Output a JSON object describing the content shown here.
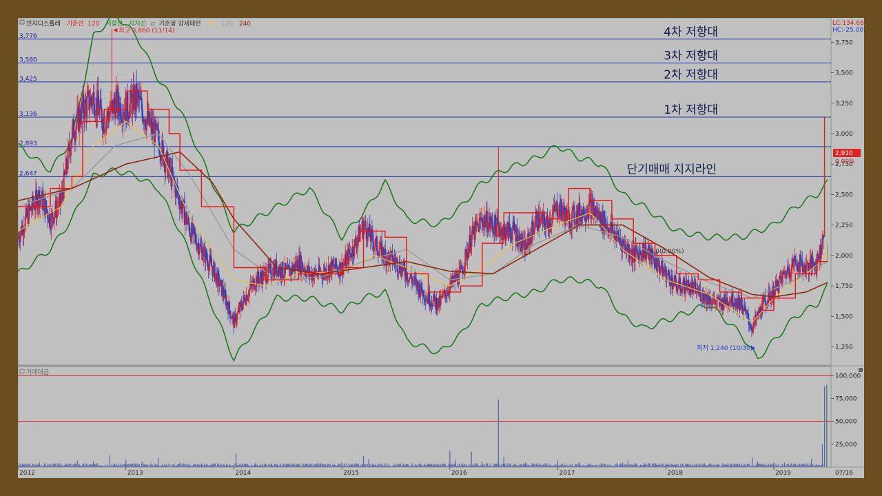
{
  "legend": {
    "title": "인지디스플레",
    "items": [
      {
        "text": "기준선",
        "color": "#dd2222"
      },
      {
        "text": "120",
        "color": "#dd2222"
      },
      {
        "text": "저항선",
        "color": "#228822"
      },
      {
        "text": "지지선",
        "color": "#228822"
      },
      {
        "text": "기준봉 강세패턴",
        "color": "#333333"
      },
      {
        "text": "60",
        "color": "#e6c24a"
      },
      {
        "text": "120",
        "color": "#999999"
      },
      {
        "text": "240",
        "color": "#8b2a10"
      }
    ]
  },
  "top_right": {
    "lc": "LC:134.68",
    "hc": "HC:-25.00"
  },
  "price_box": {
    "value": "2,910",
    "pct": "0.00%"
  },
  "volume_label": "거래대금",
  "right_marker": "07/16",
  "colors": {
    "level_line": "#2233aa",
    "price_up": "#dd2222",
    "price_down": "#2244cc",
    "ma60": "#e6c24a",
    "ma120": "#999999",
    "ma240": "#8b2a10",
    "baseline": "#ee1111",
    "band": "#1e7a1e",
    "volume": "#5566aa"
  },
  "chart_data": [
    {
      "type": "line",
      "ylim": [
        1100,
        3950
      ],
      "x_tick_labels": [
        "2012",
        "2013",
        "2014",
        "2015",
        "2016",
        "2017",
        "2018",
        "2019"
      ],
      "y_ticks": [
        1250,
        1500,
        1750,
        2000,
        2250,
        2500,
        2750,
        3000,
        3250,
        3500,
        3750
      ],
      "y_tick_labels": [
        "1,250",
        "1,500",
        "1,750",
        "2,000",
        "2,250",
        "2,500",
        "2,750",
        "3,000",
        "3,250",
        "3,500",
        "3,750"
      ],
      "levels": [
        {
          "value": 3776,
          "label": "3,776",
          "zone": "4차 저항대"
        },
        {
          "value": 3580,
          "label": "3,580",
          "zone": "3차 저항대"
        },
        {
          "value": 3425,
          "label": "3,425",
          "zone": "2차 저항대"
        },
        {
          "value": 3136,
          "label": "3,136",
          "zone": "1차 저항대"
        },
        {
          "value": 2893,
          "label": "2,893",
          "zone": ""
        },
        {
          "value": 2647,
          "label": "2,647",
          "zone": "단기매매 지지라인"
        }
      ],
      "annotations": [
        {
          "text": "최고 3,860 (11/14)",
          "x": 2012.87,
          "y": 3860
        },
        {
          "text": "최저 1,240 (10/30)",
          "x": 2018.83,
          "y": 1240
        },
        {
          "text": "2,0(0.00%)",
          "x": 2017.85,
          "y": 2020
        }
      ],
      "series": [
        {
          "role": "close",
          "x": [
            2012.0,
            2012.1,
            2012.2,
            2012.3,
            2012.4,
            2012.5,
            2012.6,
            2012.7,
            2012.8,
            2012.9,
            2013.0,
            2013.1,
            2013.2,
            2013.3,
            2013.4,
            2013.5,
            2013.6,
            2013.7,
            2013.8,
            2013.9,
            2014.0,
            2014.1,
            2014.2,
            2014.3,
            2014.4,
            2014.5,
            2014.6,
            2014.7,
            2014.8,
            2014.9,
            2015.0,
            2015.1,
            2015.2,
            2015.3,
            2015.4,
            2015.5,
            2015.6,
            2015.7,
            2015.8,
            2015.9,
            2016.0,
            2016.1,
            2016.2,
            2016.3,
            2016.4,
            2016.5,
            2016.6,
            2016.7,
            2016.8,
            2016.9,
            2017.0,
            2017.1,
            2017.2,
            2017.3,
            2017.4,
            2017.5,
            2017.6,
            2017.7,
            2017.8,
            2017.9,
            2018.0,
            2018.1,
            2018.2,
            2018.3,
            2018.4,
            2018.5,
            2018.6,
            2018.7,
            2018.8,
            2018.9,
            2019.0,
            2019.1,
            2019.2,
            2019.3,
            2019.4,
            2019.45,
            2019.5
          ],
          "values": [
            2150,
            2350,
            2500,
            2300,
            2450,
            3000,
            3200,
            3300,
            3100,
            3250,
            3200,
            3300,
            3100,
            2950,
            2700,
            2450,
            2200,
            2050,
            1900,
            1700,
            1450,
            1650,
            1800,
            1850,
            1900,
            1850,
            1950,
            1850,
            1850,
            1900,
            1900,
            2050,
            2250,
            2100,
            2000,
            1950,
            1850,
            1750,
            1650,
            1600,
            1750,
            1850,
            2150,
            2300,
            2250,
            2200,
            2200,
            2050,
            2300,
            2250,
            2400,
            2300,
            2350,
            2400,
            2300,
            2200,
            2100,
            2000,
            2050,
            1950,
            1850,
            1750,
            1750,
            1700,
            1650,
            1600,
            1650,
            1600,
            1400,
            1600,
            1700,
            1850,
            1950,
            1900,
            1950,
            2100,
            2700
          ]
        },
        {
          "name": "60",
          "x": [
            2012.0,
            2012.4,
            2012.7,
            2013.0,
            2013.3,
            2013.6,
            2014.0,
            2014.3,
            2014.6,
            2015.0,
            2015.3,
            2015.6,
            2016.0,
            2016.3,
            2016.6,
            2017.0,
            2017.3,
            2017.6,
            2018.0,
            2018.4,
            2018.8,
            2019.0,
            2019.3,
            2019.5
          ],
          "values": [
            2200,
            2400,
            2900,
            3100,
            2900,
            2300,
            1800,
            1750,
            1850,
            1870,
            2000,
            1900,
            1750,
            1900,
            2100,
            2250,
            2350,
            2050,
            1800,
            1680,
            1450,
            1650,
            1850,
            2000
          ]
        },
        {
          "name": "120",
          "x": [
            2012.0,
            2012.5,
            2012.9,
            2013.3,
            2013.6,
            2014.0,
            2014.4,
            2014.8,
            2015.2,
            2015.6,
            2016.0,
            2016.4,
            2016.8,
            2017.2,
            2017.6,
            2018.0,
            2018.4,
            2018.8,
            2019.2,
            2019.5
          ],
          "values": [
            2400,
            2550,
            2900,
            3000,
            2650,
            2050,
            1800,
            1820,
            1950,
            2050,
            1800,
            1850,
            2100,
            2250,
            2150,
            1950,
            1780,
            1650,
            1800,
            1950
          ]
        },
        {
          "name": "240",
          "x": [
            2012.0,
            2012.5,
            2013.0,
            2013.5,
            2013.8,
            2014.0,
            2014.4,
            2014.8,
            2015.2,
            2015.6,
            2016.0,
            2016.4,
            2016.8,
            2017.2,
            2017.6,
            2018.0,
            2018.4,
            2018.8,
            2019.0,
            2019.3,
            2019.5
          ],
          "values": [
            2450,
            2550,
            2750,
            2850,
            2600,
            2300,
            1900,
            1850,
            1900,
            1950,
            1870,
            1850,
            2050,
            2250,
            2250,
            2050,
            1820,
            1680,
            1660,
            1700,
            1780
          ]
        },
        {
          "name": "기준선",
          "x": [
            2012.0,
            2012.3,
            2012.5,
            2012.6,
            2012.8,
            2013.0,
            2013.2,
            2013.4,
            2013.5,
            2013.7,
            2014.0,
            2014.3,
            2014.6,
            2015.0,
            2015.2,
            2015.4,
            2015.6,
            2015.8,
            2016.1,
            2016.3,
            2016.5,
            2016.7,
            2016.9,
            2017.1,
            2017.3,
            2017.5,
            2017.7,
            2017.9,
            2018.1,
            2018.3,
            2018.5,
            2018.7,
            2018.9,
            2019.0,
            2019.2,
            2019.4,
            2019.5
          ],
          "values": [
            2400,
            2550,
            2650,
            3100,
            3200,
            3350,
            3200,
            3000,
            2700,
            2400,
            1900,
            1800,
            1850,
            1900,
            2200,
            2150,
            1850,
            1700,
            1750,
            2100,
            2350,
            2350,
            2300,
            2550,
            2450,
            2300,
            2100,
            2000,
            1850,
            1800,
            1700,
            1650,
            1550,
            1650,
            1850,
            1950,
            2100
          ]
        },
        {
          "name": "저항선",
          "x": [
            2012.0,
            2012.3,
            2012.5,
            2012.7,
            2012.9,
            2013.1,
            2013.3,
            2013.5,
            2013.7,
            2014.0,
            2014.4,
            2014.7,
            2015.0,
            2015.2,
            2015.4,
            2015.6,
            2015.9,
            2016.1,
            2016.3,
            2016.5,
            2016.8,
            2017.0,
            2017.2,
            2017.4,
            2017.6,
            2017.8,
            2018.1,
            2018.4,
            2018.7,
            2019.0,
            2019.2,
            2019.4,
            2019.5
          ],
          "values": [
            2900,
            2700,
            2950,
            3800,
            3980,
            3800,
            3450,
            3200,
            2800,
            2200,
            2400,
            2550,
            2150,
            2350,
            2600,
            2300,
            2250,
            2400,
            2600,
            2700,
            2800,
            2900,
            2800,
            2750,
            2500,
            2400,
            2200,
            2150,
            2150,
            2250,
            2400,
            2500,
            2600
          ]
        },
        {
          "name": "지지선",
          "x": [
            2012.0,
            2012.3,
            2012.5,
            2012.7,
            2012.9,
            2013.1,
            2013.3,
            2013.5,
            2013.7,
            2014.0,
            2014.4,
            2014.7,
            2015.0,
            2015.2,
            2015.4,
            2015.6,
            2015.9,
            2016.1,
            2016.3,
            2016.5,
            2016.8,
            2017.0,
            2017.2,
            2017.4,
            2017.6,
            2017.8,
            2018.1,
            2018.4,
            2018.7,
            2018.85,
            2019.0,
            2019.2,
            2019.4,
            2019.5
          ],
          "values": [
            1850,
            2050,
            2300,
            2650,
            2700,
            2650,
            2550,
            2200,
            1800,
            1150,
            1650,
            1650,
            1550,
            1650,
            1700,
            1300,
            1200,
            1350,
            1600,
            1650,
            1700,
            1800,
            1800,
            1750,
            1500,
            1400,
            1500,
            1600,
            1350,
            1150,
            1300,
            1500,
            1600,
            1750
          ]
        }
      ]
    },
    {
      "type": "bar",
      "ylim": [
        0,
        110000
      ],
      "y_ticks": [
        25000,
        50000,
        75000,
        100000
      ],
      "y_tick_labels": [
        "25,000",
        "50,000",
        "75,000",
        "100,000"
      ],
      "ref_lines": [
        100000,
        50000
      ],
      "x": [
        2012.05,
        2012.2,
        2012.4,
        2012.55,
        2012.7,
        2012.85,
        2013.0,
        2013.15,
        2013.3,
        2013.5,
        2013.7,
        2013.9,
        2014.02,
        2014.2,
        2014.4,
        2014.6,
        2014.8,
        2015.0,
        2015.2,
        2015.25,
        2015.4,
        2015.6,
        2015.8,
        2016.0,
        2016.05,
        2016.2,
        2016.3,
        2016.45,
        2016.5,
        2016.7,
        2016.9,
        2017.0,
        2017.2,
        2017.4,
        2017.6,
        2017.65,
        2017.8,
        2018.0,
        2018.2,
        2018.4,
        2018.6,
        2018.8,
        2018.85,
        2019.0,
        2019.1,
        2019.2,
        2019.3,
        2019.35,
        2019.45,
        2019.47,
        2019.49
      ],
      "values": [
        3000,
        5000,
        4000,
        7000,
        6000,
        13000,
        8000,
        6000,
        10000,
        5000,
        4000,
        3000,
        15000,
        4000,
        3000,
        3000,
        4000,
        5000,
        12000,
        9000,
        4000,
        3000,
        3000,
        18000,
        8000,
        17000,
        6000,
        74000,
        11000,
        5000,
        4000,
        7000,
        5000,
        4000,
        5000,
        7000,
        4000,
        4000,
        3000,
        3000,
        3000,
        10000,
        6000,
        5000,
        5000,
        4000,
        4000,
        9000,
        25000,
        88000,
        90000
      ]
    }
  ]
}
